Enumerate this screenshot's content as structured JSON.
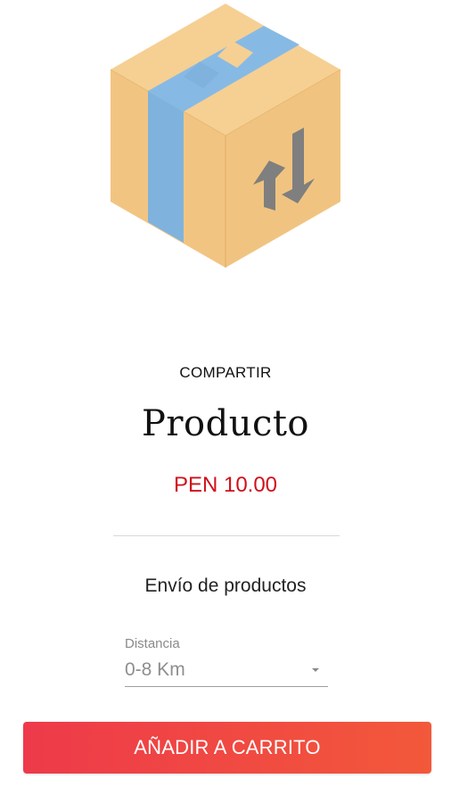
{
  "product": {
    "image_icon": "box-icon",
    "share_label": "COMPARTIR",
    "title": "Producto",
    "price": "PEN 10.00"
  },
  "shipping": {
    "section_title": "Envío de productos",
    "distance_label": "Distancia",
    "distance_value": "0-8 Km"
  },
  "actions": {
    "add_to_cart_label": "AÑADIR A CARRITO"
  },
  "colors": {
    "price": "#d0101a",
    "button_start": "#ee3a4a",
    "button_end": "#f2583a",
    "box_cardboard": "#f3c98b",
    "box_tape": "#7fb3de"
  }
}
